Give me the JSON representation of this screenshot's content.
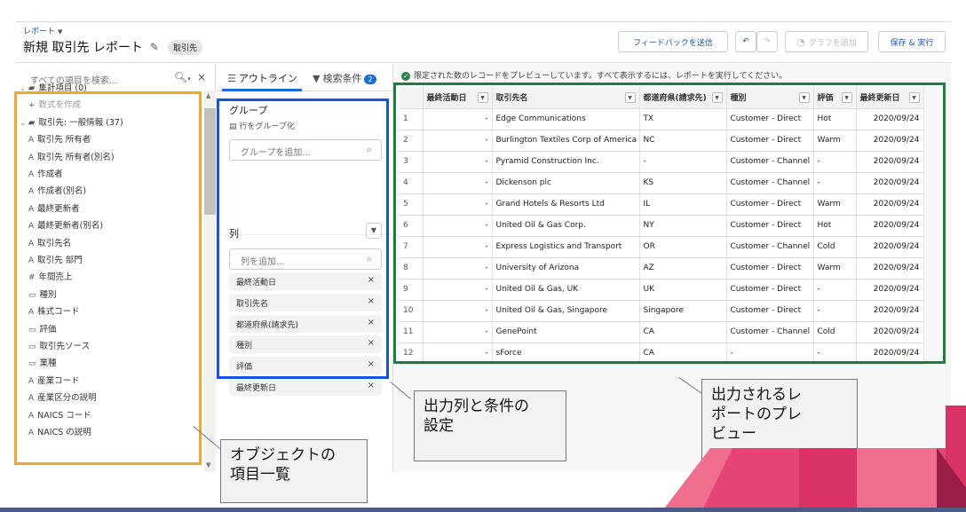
{
  "header": {
    "breadcrumb": "レポート",
    "title": "新規 取引先 レポート",
    "type_badge": "取引先",
    "feedback_button": "フィードバックを送信",
    "undo_icon": "undo-icon",
    "redo_icon": "redo-icon",
    "add_chart_button": "グラフを追加",
    "save_run_button": "保存 & 実行"
  },
  "fields_panel": {
    "search_placeholder": "すべての項目を検索...",
    "items": [
      {
        "kind": "folder",
        "label": "集計項目 (0)"
      },
      {
        "kind": "add",
        "label": "数式を作成"
      },
      {
        "kind": "folder",
        "label": "取引先: 一般情報 (37)"
      },
      {
        "kind": "text",
        "type_icon": "A",
        "label": "取引先 所有者"
      },
      {
        "kind": "text",
        "type_icon": "A",
        "label": "取引先 所有者(別名)"
      },
      {
        "kind": "text",
        "type_icon": "A",
        "label": "作成者"
      },
      {
        "kind": "text",
        "type_icon": "A",
        "label": "作成者(別名)"
      },
      {
        "kind": "text",
        "type_icon": "A",
        "label": "最終更新者"
      },
      {
        "kind": "text",
        "type_icon": "A",
        "label": "最終更新者(別名)"
      },
      {
        "kind": "text",
        "type_icon": "A",
        "label": "取引先名"
      },
      {
        "kind": "text",
        "type_icon": "A",
        "label": "取引先 部門"
      },
      {
        "kind": "number",
        "type_icon": "#",
        "label": "年間売上"
      },
      {
        "kind": "picklist",
        "type_icon": "▭",
        "label": "種別"
      },
      {
        "kind": "text",
        "type_icon": "A",
        "label": "株式コード"
      },
      {
        "kind": "picklist",
        "type_icon": "▭",
        "label": "評価"
      },
      {
        "kind": "picklist",
        "type_icon": "▭",
        "label": "取引先ソース"
      },
      {
        "kind": "picklist",
        "type_icon": "▭",
        "label": "業種"
      },
      {
        "kind": "text",
        "type_icon": "A",
        "label": "産業コード"
      },
      {
        "kind": "text",
        "type_icon": "A",
        "label": "産業区分の説明"
      },
      {
        "kind": "text",
        "type_icon": "A",
        "label": "NAICS コード"
      },
      {
        "kind": "text",
        "type_icon": "A",
        "label": "NAICS の説明"
      }
    ]
  },
  "outline_panel": {
    "tab_outline": "アウトライン",
    "tab_filters": "検索条件",
    "filters_count": "2",
    "group_heading": "グループ",
    "group_rows": "行をグループ化",
    "group_placeholder": "グループを追加...",
    "columns_heading": "列",
    "column_placeholder": "列を追加...",
    "columns": [
      "最終活動日",
      "取引先名",
      "都道府県(請求先)",
      "種別",
      "評価",
      "最終更新日"
    ]
  },
  "preview": {
    "info": "限定された数のレコードをプレビューしています。すべて表示するには、レポートを実行してください。",
    "headers": [
      "最終活動日",
      "取引先名",
      "都道府県(請求先)",
      "種別",
      "評価",
      "最終更新日"
    ],
    "rows": [
      [
        "1",
        "-",
        "Edge Communications",
        "TX",
        "Customer - Direct",
        "Hot",
        "2020/09/24"
      ],
      [
        "2",
        "-",
        "Burlington Textiles Corp of America",
        "NC",
        "Customer - Direct",
        "Warm",
        "2020/09/24"
      ],
      [
        "3",
        "-",
        "Pyramid Construction Inc.",
        "-",
        "Customer - Channel",
        "-",
        "2020/09/24"
      ],
      [
        "4",
        "-",
        "Dickenson plc",
        "KS",
        "Customer - Channel",
        "-",
        "2020/09/24"
      ],
      [
        "5",
        "-",
        "Grand Hotels & Resorts Ltd",
        "IL",
        "Customer - Direct",
        "Warm",
        "2020/09/24"
      ],
      [
        "6",
        "-",
        "United Oil & Gas Corp.",
        "NY",
        "Customer - Direct",
        "Hot",
        "2020/09/24"
      ],
      [
        "7",
        "-",
        "Express Logistics and Transport",
        "OR",
        "Customer - Channel",
        "Cold",
        "2020/09/24"
      ],
      [
        "8",
        "-",
        "University of Arizona",
        "AZ",
        "Customer - Direct",
        "Warm",
        "2020/09/24"
      ],
      [
        "9",
        "-",
        "United Oil & Gas, UK",
        "UK",
        "Customer - Direct",
        "-",
        "2020/09/24"
      ],
      [
        "10",
        "-",
        "United Oil & Gas, Singapore",
        "Singapore",
        "Customer - Direct",
        "-",
        "2020/09/24"
      ],
      [
        "11",
        "-",
        "GenePoint",
        "CA",
        "Customer - Channel",
        "Cold",
        "2020/09/24"
      ],
      [
        "12",
        "-",
        "sForce",
        "CA",
        "-",
        "-",
        "2020/09/24"
      ]
    ]
  },
  "annotations": {
    "objects": "オブジェクトの\n項目一覧",
    "columns": "出力列と条件の\n設定",
    "preview": "出力されるレ\nポートのプレ\nビュー",
    "colors": {
      "orange": "#f5a623",
      "blue": "#1553e8",
      "green": "#1e7b46"
    }
  },
  "colors": {
    "accent": "#1a56b8",
    "pink": "#e8336f",
    "navy": "#4a5a8a"
  }
}
